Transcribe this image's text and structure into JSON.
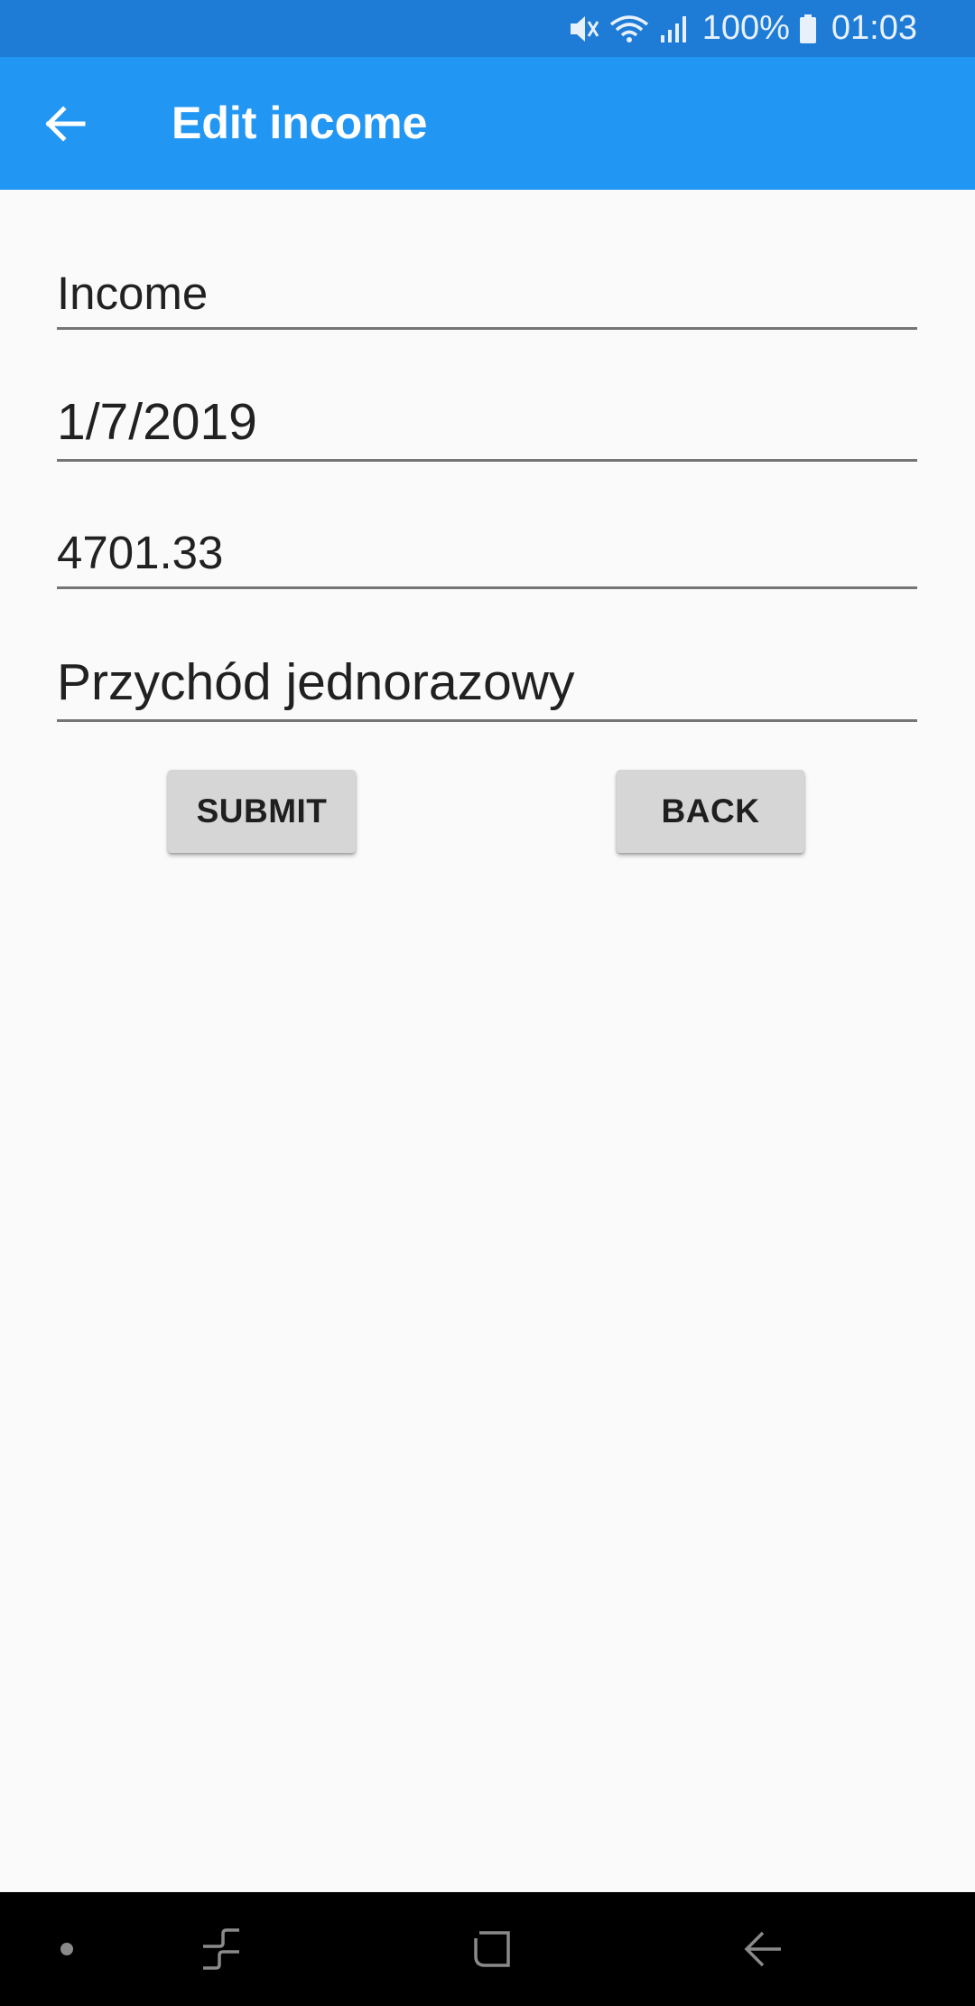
{
  "status_bar": {
    "battery_percent": "100%",
    "time": "01:03",
    "icons": [
      "mute-icon",
      "wifi-icon",
      "signal-icon",
      "battery-icon"
    ],
    "background": "#1e7bd6"
  },
  "toolbar": {
    "title": "Edit income",
    "back_icon": "arrow-left-icon",
    "background": "#2196f3"
  },
  "form": {
    "type_value": "Income",
    "date_value": "1/7/2019",
    "amount_value": "4701.33",
    "description_value": "Przychód jednorazowy"
  },
  "buttons": {
    "submit_label": "SUBMIT",
    "back_label": "BACK"
  },
  "nav_bar": {
    "icons": [
      "dot-icon",
      "recents-icon",
      "home-icon",
      "back-icon"
    ]
  }
}
